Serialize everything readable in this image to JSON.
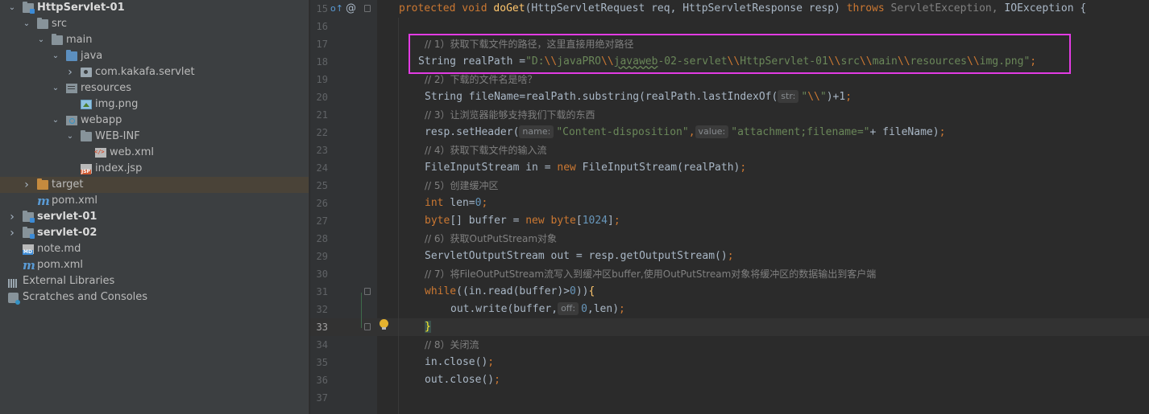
{
  "tree": [
    {
      "label": "HttpServlet-01",
      "bold": true,
      "icon": "module-folder-icon",
      "chev": "down",
      "indent": 0
    },
    {
      "label": "src",
      "icon": "folder-icon",
      "chev": "down",
      "indent": 1
    },
    {
      "label": "main",
      "icon": "folder-icon",
      "chev": "down",
      "indent": 2
    },
    {
      "label": "java",
      "icon": "source-folder-icon",
      "chev": "down",
      "indent": 3
    },
    {
      "label": "com.kakafa.servlet",
      "icon": "package-icon",
      "chev": "right",
      "indent": 4
    },
    {
      "label": "resources",
      "icon": "resources-folder-icon",
      "chev": "down",
      "indent": 3
    },
    {
      "label": "img.png",
      "icon": "image-file-icon",
      "chev": "",
      "indent": 4
    },
    {
      "label": "webapp",
      "icon": "web-folder-icon",
      "chev": "down",
      "indent": 3
    },
    {
      "label": "WEB-INF",
      "icon": "folder-icon",
      "chev": "down",
      "indent": 4
    },
    {
      "label": "web.xml",
      "icon": "xml-file-icon",
      "chev": "",
      "indent": 5
    },
    {
      "label": "index.jsp",
      "icon": "jsp-file-icon",
      "chev": "",
      "indent": 4
    },
    {
      "label": "target",
      "icon": "excluded-folder-icon",
      "chev": "right",
      "indent": 1,
      "selected": true
    },
    {
      "label": "pom.xml",
      "icon": "maven-icon",
      "chev": "",
      "indent": 1
    },
    {
      "label": "servlet-01",
      "bold": true,
      "icon": "module-folder-icon",
      "chev": "right",
      "indent": 0
    },
    {
      "label": "servlet-02",
      "bold": true,
      "icon": "module-folder-icon",
      "chev": "right",
      "indent": 0
    },
    {
      "label": "note.md",
      "icon": "markdown-file-icon",
      "chev": "",
      "indent": 0
    },
    {
      "label": "pom.xml",
      "icon": "maven-icon",
      "chev": "",
      "indent": 0
    },
    {
      "label": "External Libraries",
      "icon": "libraries-icon",
      "chev": "",
      "indent": -1
    },
    {
      "label": "Scratches and Consoles",
      "icon": "scratches-icon",
      "chev": "",
      "indent": -1
    }
  ],
  "maven_glyph": "m",
  "gutter": {
    "override_marker": "o↑",
    "annotation_marker": "@"
  },
  "code": {
    "line_numbers": [
      "15",
      "16",
      "17",
      "18",
      "19",
      "20",
      "21",
      "22",
      "23",
      "24",
      "25",
      "26",
      "27",
      "28",
      "29",
      "30",
      "31",
      "32",
      "33",
      "34",
      "35",
      "36",
      "37"
    ],
    "current_line": "33",
    "l15": {
      "protected": "protected",
      "void": "void",
      "name": "doGet",
      "sig1": "(HttpServletRequest req, HttpServletResponse resp) ",
      "throws": "throws",
      "exc": " ServletException, ",
      "ioe": "IOException {"
    },
    "l17": {
      "comment": "// 1）获取下载文件的路径，这里直接用绝对路径"
    },
    "l18": {
      "decl": "String realPath =",
      "q1": "\"D:",
      "e1": "\\\\",
      "s1": "javaPRO",
      "e2": "\\\\",
      "s2": "javaweb",
      "s2b": "-02-servlet",
      "e3": "\\\\",
      "s3": "HttpServlet-01",
      "e4": "\\\\",
      "s4": "src",
      "e5": "\\\\",
      "s5": "main",
      "e6": "\\\\",
      "s6": "resources",
      "e7": "\\\\",
      "s7": "img.png\"",
      "end": ";"
    },
    "l19": {
      "comment": "// 2）下载的文件名是啥？"
    },
    "l20": {
      "pre": "String fileName=realPath.substring(realPath.lastIndexOf(",
      "hint": "str:",
      "q": "\"",
      "esc": "\\\\",
      "q2": "\"",
      "post": ")+1",
      ";": ";"
    },
    "l21": {
      "comment": "// 3）让浏览器能够支持我们下载的东西"
    },
    "l22": {
      "pre": "resp.setHeader(",
      "hint1": "name:",
      "s1": "\"Content-disposition\"",
      "comma": ",",
      "hint2": "value:",
      "s2": "\"attachment;filename=\"",
      "post": "+ fileName)",
      ";": ";"
    },
    "l23": {
      "comment": "// 4）获取下载文件的输入流"
    },
    "l24": {
      "pre": "FileInputStream in = ",
      "new": "new",
      "post": " FileInputStream(realPath)",
      ";": ";"
    },
    "l25": {
      "comment": "// 5）创建缓冲区"
    },
    "l26": {
      "int": "int",
      "mid": " len=",
      "num": "0",
      ";": ";"
    },
    "l27": {
      "byte": "byte",
      "mid": "[] buffer = ",
      "new": "new",
      "sp": " ",
      "byte2": "byte",
      "lb": "[",
      "num": "1024",
      "rb": "]",
      ";": ";"
    },
    "l28": {
      "comment": "// 6）获取OutPutStream对象"
    },
    "l29": {
      "pre": "ServletOutputStream out = resp.getOutputStream()",
      ";": ";"
    },
    "l30": {
      "comment": "// 7）将FileOutPutStream流写入到缓冲区buffer,使用OutPutStream对象将缓冲区的数据输出到客户端"
    },
    "l31": {
      "while": "while",
      "mid": "((in.read(buffer)>",
      "num": "0",
      "close": "))",
      "brace": "{"
    },
    "l32": {
      "pre": "out.write(buffer,",
      "hint": "off:",
      "num": "0",
      "post": ",len)",
      ";": ";"
    },
    "l33": {
      "brace": "}"
    },
    "l34": {
      "comment": "// 8）关闭流"
    },
    "l35": {
      "pre": "in.close()",
      ";": ";"
    },
    "l36": {
      "pre": "out.close()",
      ";": ";"
    }
  }
}
